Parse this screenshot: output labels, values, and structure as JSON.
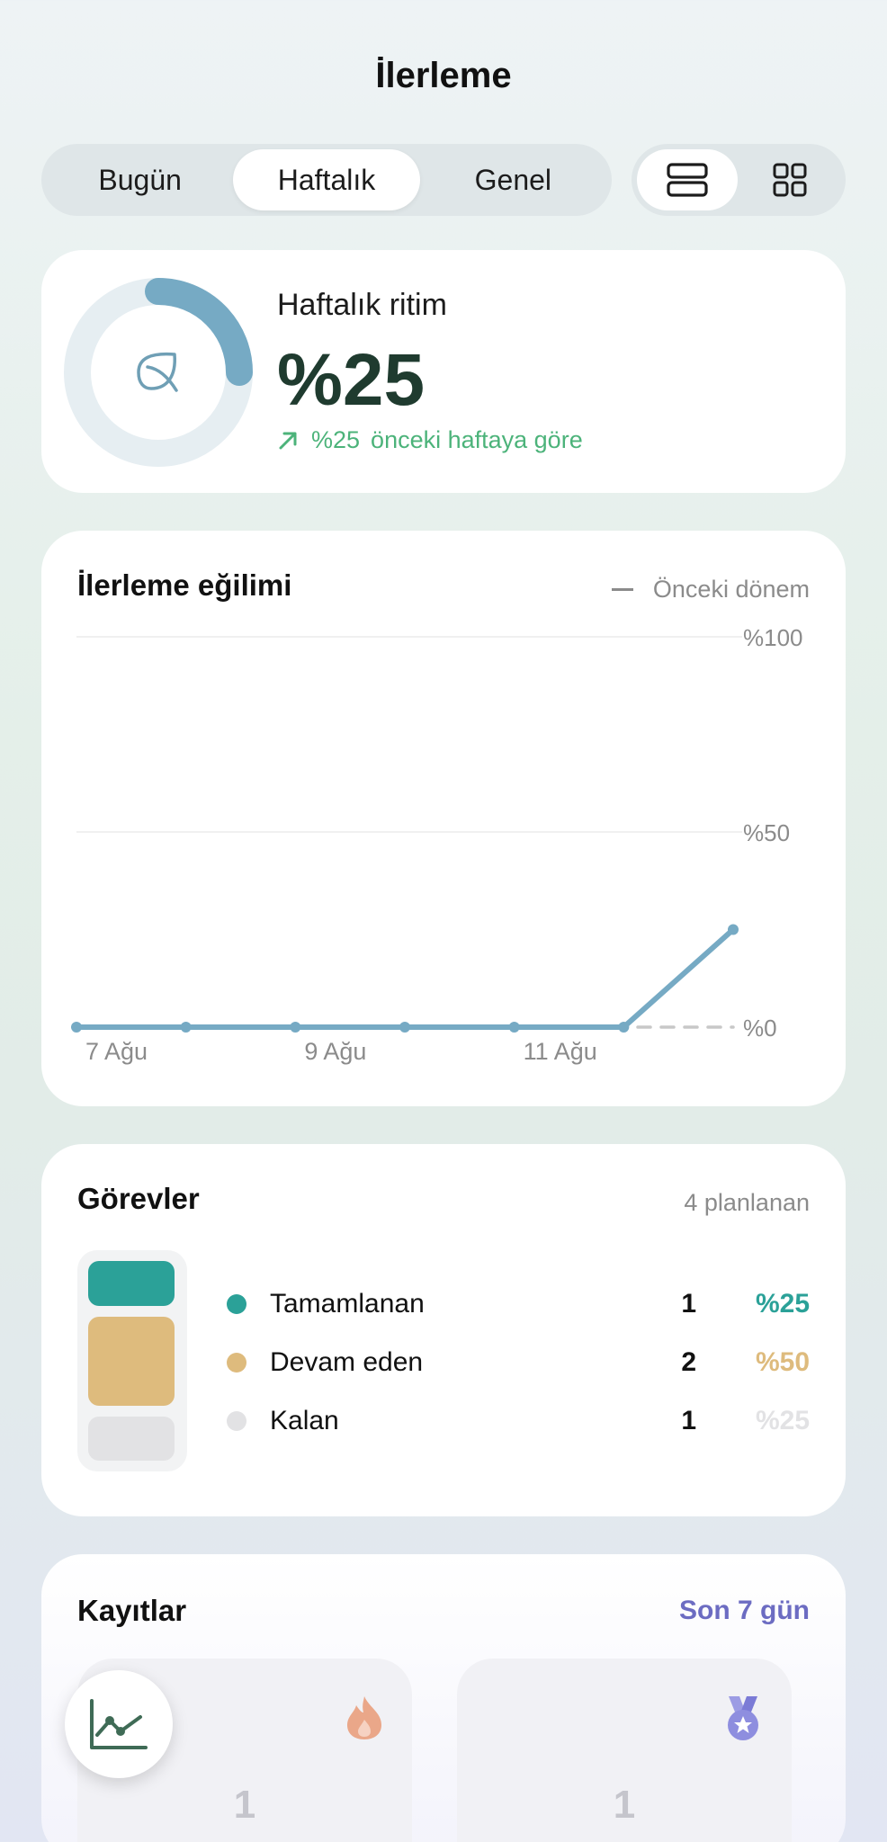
{
  "header": {
    "title": "İlerleme"
  },
  "period_tabs": [
    {
      "label": "Bugün",
      "active": false
    },
    {
      "label": "Haftalık",
      "active": true
    },
    {
      "label": "Genel",
      "active": false
    }
  ],
  "view_toggle": {
    "selected": "list",
    "icons": [
      "list-view-icon",
      "grid-view-icon"
    ]
  },
  "rhythm": {
    "label": "Haftalık ritim",
    "value": "%25",
    "progress": 0.25,
    "change_value": "%25",
    "change_text": "önceki haftaya göre",
    "colors": {
      "ring": "#76aac4",
      "track": "#e6eef2",
      "value": "#1f3b2f",
      "change": "#4cb37a"
    }
  },
  "trend": {
    "title": "İlerleme eğilimi",
    "legend_label": "Önceki dönem"
  },
  "chart_data": {
    "type": "line",
    "title": "İlerleme eğilimi",
    "x": [
      "7 Ağu",
      "8 Ağu",
      "9 Ağu",
      "10 Ağu",
      "11 Ağu",
      "12 Ağu",
      "13 Ağu"
    ],
    "x_tick_labels": [
      "7 Ağu",
      "9 Ağu",
      "11 Ağu"
    ],
    "y_tick_labels": [
      "%100",
      "%50",
      "%0"
    ],
    "ylim": [
      0,
      100
    ],
    "series": [
      {
        "values": [
          0,
          0,
          0,
          0,
          0,
          0,
          25
        ],
        "color": "#76aac4",
        "style": "solid"
      },
      {
        "name": "Önceki dönem",
        "values": [
          0,
          0,
          0,
          0,
          0,
          0,
          0
        ],
        "color": "#c8c8c8",
        "style": "dashed"
      }
    ],
    "grid": true
  },
  "tasks": {
    "title": "Görevler",
    "planned": "4 planlanan",
    "items": [
      {
        "name": "Tamamlanan",
        "count": "1",
        "pct": "%25",
        "color": "#2ba198",
        "fraction": 0.25
      },
      {
        "name": "Devam eden",
        "count": "2",
        "pct": "%50",
        "color": "#debb7d",
        "fraction": 0.5
      },
      {
        "name": "Kalan",
        "count": "1",
        "pct": "%25",
        "color": "#e2e2e4",
        "fraction": 0.25
      }
    ]
  },
  "records": {
    "title": "Kayıtlar",
    "range": "Son 7 gün",
    "boxes": [
      {
        "value": "1",
        "icon": "flame-icon"
      },
      {
        "value": "1",
        "icon": "medal-icon"
      }
    ]
  },
  "fab": {
    "icon": "line-chart-icon"
  }
}
